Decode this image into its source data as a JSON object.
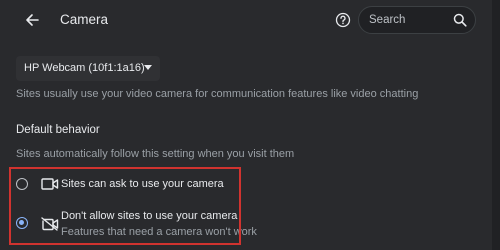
{
  "header": {
    "title": "Camera",
    "search_placeholder": "Search",
    "back_icon": "arrow-back-icon",
    "help_icon": "help-circle-icon",
    "search_icon": "search-icon"
  },
  "device": {
    "selected": "HP Webcam (10f1:1a16)"
  },
  "help_text": "Sites usually use your video camera for communication features like video chatting",
  "default_behavior": {
    "title": "Default behavior",
    "description": "Sites automatically follow this setting when you visit them",
    "options": [
      {
        "label": "Sites can ask to use your camera",
        "selected": false,
        "icon": "camera-icon"
      },
      {
        "label": "Don't allow sites to use your camera",
        "sublabel": "Features that need a camera won't work",
        "selected": true,
        "icon": "camera-off-icon"
      }
    ]
  },
  "colors": {
    "background": "#292a2d",
    "accent": "#8ab4f8",
    "highlight": "#d0332f"
  }
}
